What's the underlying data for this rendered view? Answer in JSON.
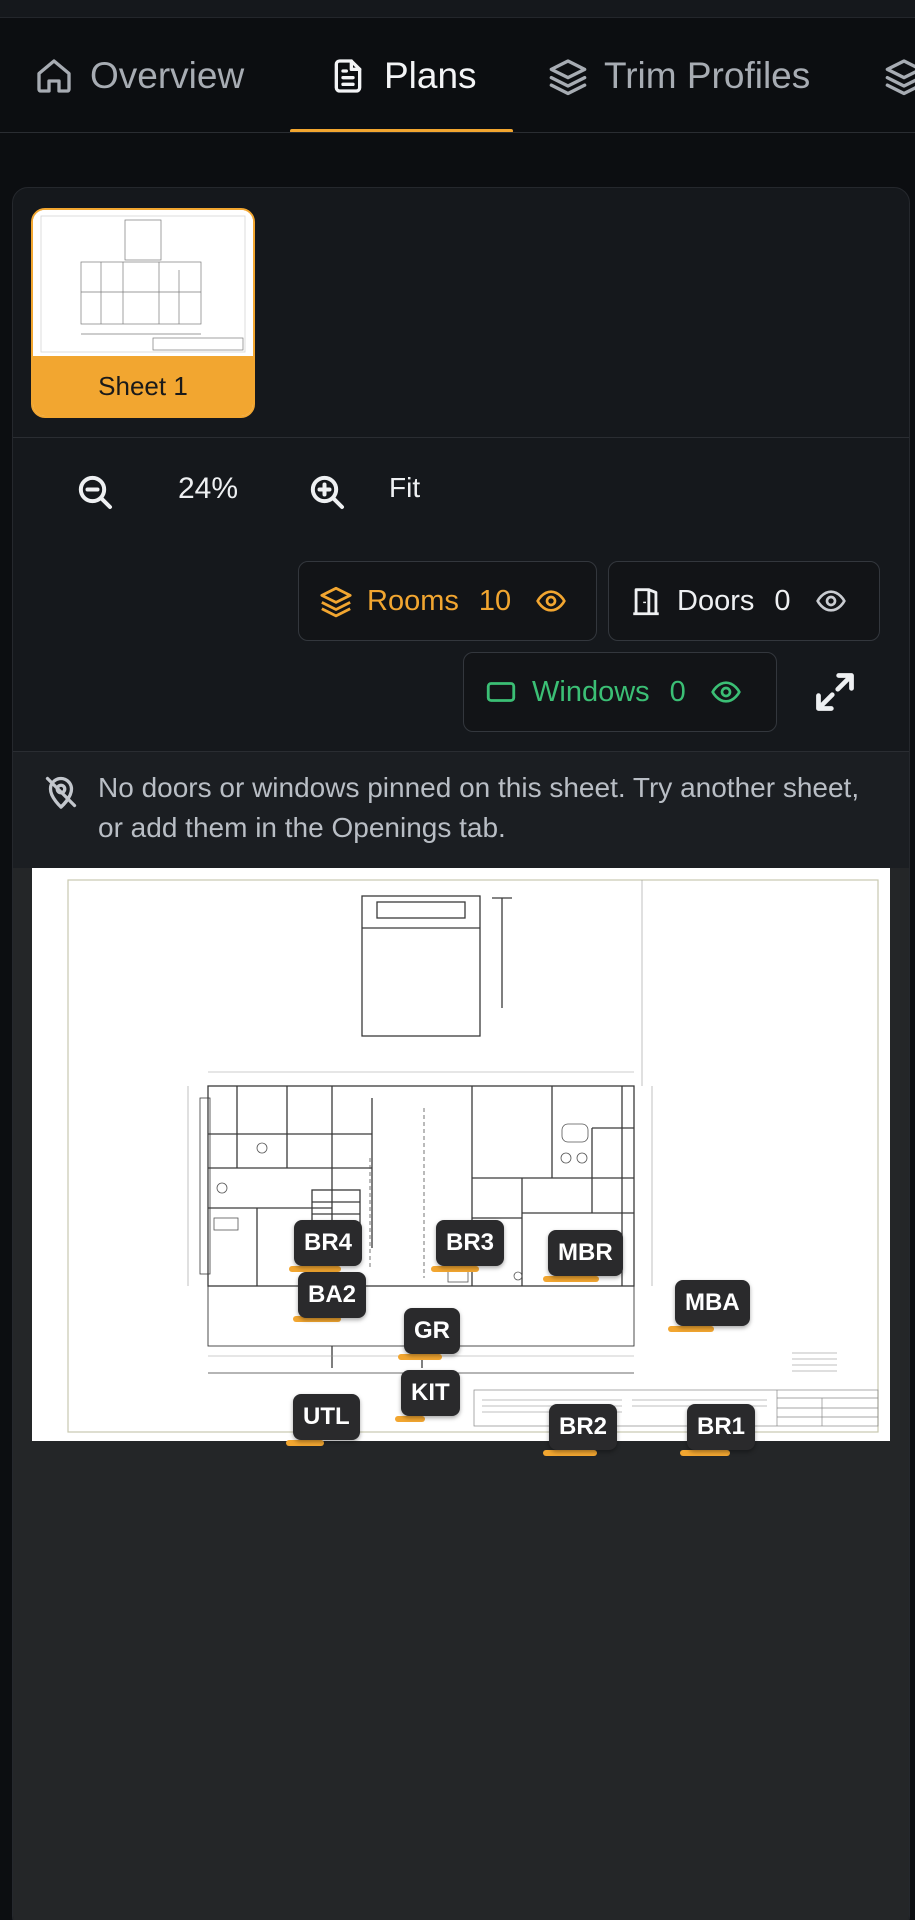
{
  "tabs": [
    {
      "label": "Overview",
      "icon": "home-icon"
    },
    {
      "label": "Plans",
      "icon": "document-icon",
      "active": true
    },
    {
      "label": "Trim Profiles",
      "icon": "layers-icon"
    }
  ],
  "sheets": [
    {
      "label": "Sheet 1",
      "selected": true
    }
  ],
  "zoom": {
    "value": "24%",
    "fit_label": "Fit"
  },
  "layers": {
    "rooms": {
      "label": "Rooms",
      "count": "10",
      "color": "#f2a630"
    },
    "doors": {
      "label": "Doors",
      "count": "0",
      "color": "#eef0f2"
    },
    "windows": {
      "label": "Windows",
      "count": "0",
      "color": "#3bbf75"
    }
  },
  "notice": {
    "text": "No doors or windows pinned on this sheet. Try another sheet, or add them in the Openings tab."
  },
  "rooms": [
    "BR4",
    "BR3",
    "MBR",
    "BA2",
    "MBA",
    "GR",
    "KIT",
    "UTL",
    "BR2",
    "BR1"
  ],
  "colors": {
    "accent": "#f2a630",
    "success": "#3bbf75",
    "background": "#0c0e11",
    "card": "#15181c"
  }
}
